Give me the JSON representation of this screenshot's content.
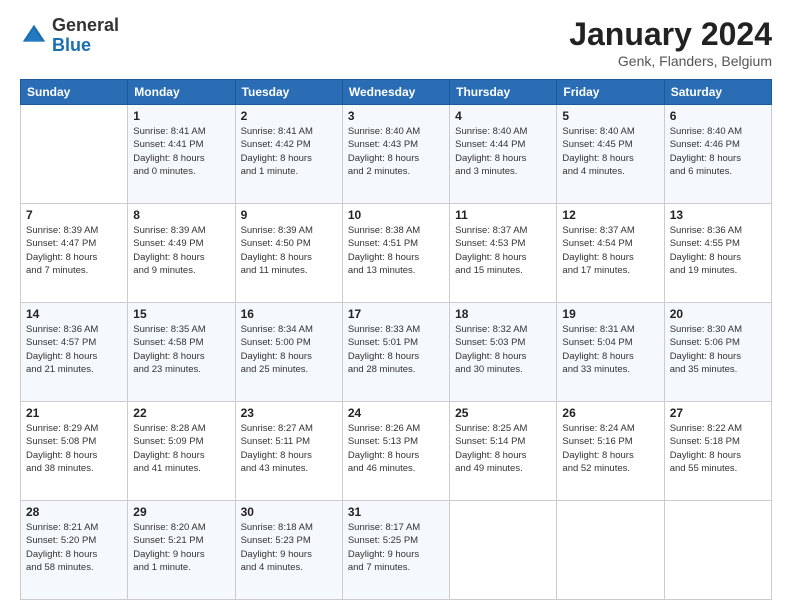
{
  "logo": {
    "general": "General",
    "blue": "Blue"
  },
  "title": "January 2024",
  "subtitle": "Genk, Flanders, Belgium",
  "calendar": {
    "headers": [
      "Sunday",
      "Monday",
      "Tuesday",
      "Wednesday",
      "Thursday",
      "Friday",
      "Saturday"
    ],
    "rows": [
      [
        {
          "day": "",
          "info": ""
        },
        {
          "day": "1",
          "info": "Sunrise: 8:41 AM\nSunset: 4:41 PM\nDaylight: 8 hours\nand 0 minutes."
        },
        {
          "day": "2",
          "info": "Sunrise: 8:41 AM\nSunset: 4:42 PM\nDaylight: 8 hours\nand 1 minute."
        },
        {
          "day": "3",
          "info": "Sunrise: 8:40 AM\nSunset: 4:43 PM\nDaylight: 8 hours\nand 2 minutes."
        },
        {
          "day": "4",
          "info": "Sunrise: 8:40 AM\nSunset: 4:44 PM\nDaylight: 8 hours\nand 3 minutes."
        },
        {
          "day": "5",
          "info": "Sunrise: 8:40 AM\nSunset: 4:45 PM\nDaylight: 8 hours\nand 4 minutes."
        },
        {
          "day": "6",
          "info": "Sunrise: 8:40 AM\nSunset: 4:46 PM\nDaylight: 8 hours\nand 6 minutes."
        }
      ],
      [
        {
          "day": "7",
          "info": "Sunrise: 8:39 AM\nSunset: 4:47 PM\nDaylight: 8 hours\nand 7 minutes."
        },
        {
          "day": "8",
          "info": "Sunrise: 8:39 AM\nSunset: 4:49 PM\nDaylight: 8 hours\nand 9 minutes."
        },
        {
          "day": "9",
          "info": "Sunrise: 8:39 AM\nSunset: 4:50 PM\nDaylight: 8 hours\nand 11 minutes."
        },
        {
          "day": "10",
          "info": "Sunrise: 8:38 AM\nSunset: 4:51 PM\nDaylight: 8 hours\nand 13 minutes."
        },
        {
          "day": "11",
          "info": "Sunrise: 8:37 AM\nSunset: 4:53 PM\nDaylight: 8 hours\nand 15 minutes."
        },
        {
          "day": "12",
          "info": "Sunrise: 8:37 AM\nSunset: 4:54 PM\nDaylight: 8 hours\nand 17 minutes."
        },
        {
          "day": "13",
          "info": "Sunrise: 8:36 AM\nSunset: 4:55 PM\nDaylight: 8 hours\nand 19 minutes."
        }
      ],
      [
        {
          "day": "14",
          "info": "Sunrise: 8:36 AM\nSunset: 4:57 PM\nDaylight: 8 hours\nand 21 minutes."
        },
        {
          "day": "15",
          "info": "Sunrise: 8:35 AM\nSunset: 4:58 PM\nDaylight: 8 hours\nand 23 minutes."
        },
        {
          "day": "16",
          "info": "Sunrise: 8:34 AM\nSunset: 5:00 PM\nDaylight: 8 hours\nand 25 minutes."
        },
        {
          "day": "17",
          "info": "Sunrise: 8:33 AM\nSunset: 5:01 PM\nDaylight: 8 hours\nand 28 minutes."
        },
        {
          "day": "18",
          "info": "Sunrise: 8:32 AM\nSunset: 5:03 PM\nDaylight: 8 hours\nand 30 minutes."
        },
        {
          "day": "19",
          "info": "Sunrise: 8:31 AM\nSunset: 5:04 PM\nDaylight: 8 hours\nand 33 minutes."
        },
        {
          "day": "20",
          "info": "Sunrise: 8:30 AM\nSunset: 5:06 PM\nDaylight: 8 hours\nand 35 minutes."
        }
      ],
      [
        {
          "day": "21",
          "info": "Sunrise: 8:29 AM\nSunset: 5:08 PM\nDaylight: 8 hours\nand 38 minutes."
        },
        {
          "day": "22",
          "info": "Sunrise: 8:28 AM\nSunset: 5:09 PM\nDaylight: 8 hours\nand 41 minutes."
        },
        {
          "day": "23",
          "info": "Sunrise: 8:27 AM\nSunset: 5:11 PM\nDaylight: 8 hours\nand 43 minutes."
        },
        {
          "day": "24",
          "info": "Sunrise: 8:26 AM\nSunset: 5:13 PM\nDaylight: 8 hours\nand 46 minutes."
        },
        {
          "day": "25",
          "info": "Sunrise: 8:25 AM\nSunset: 5:14 PM\nDaylight: 8 hours\nand 49 minutes."
        },
        {
          "day": "26",
          "info": "Sunrise: 8:24 AM\nSunset: 5:16 PM\nDaylight: 8 hours\nand 52 minutes."
        },
        {
          "day": "27",
          "info": "Sunrise: 8:22 AM\nSunset: 5:18 PM\nDaylight: 8 hours\nand 55 minutes."
        }
      ],
      [
        {
          "day": "28",
          "info": "Sunrise: 8:21 AM\nSunset: 5:20 PM\nDaylight: 8 hours\nand 58 minutes."
        },
        {
          "day": "29",
          "info": "Sunrise: 8:20 AM\nSunset: 5:21 PM\nDaylight: 9 hours\nand 1 minute."
        },
        {
          "day": "30",
          "info": "Sunrise: 8:18 AM\nSunset: 5:23 PM\nDaylight: 9 hours\nand 4 minutes."
        },
        {
          "day": "31",
          "info": "Sunrise: 8:17 AM\nSunset: 5:25 PM\nDaylight: 9 hours\nand 7 minutes."
        },
        {
          "day": "",
          "info": ""
        },
        {
          "day": "",
          "info": ""
        },
        {
          "day": "",
          "info": ""
        }
      ]
    ]
  }
}
